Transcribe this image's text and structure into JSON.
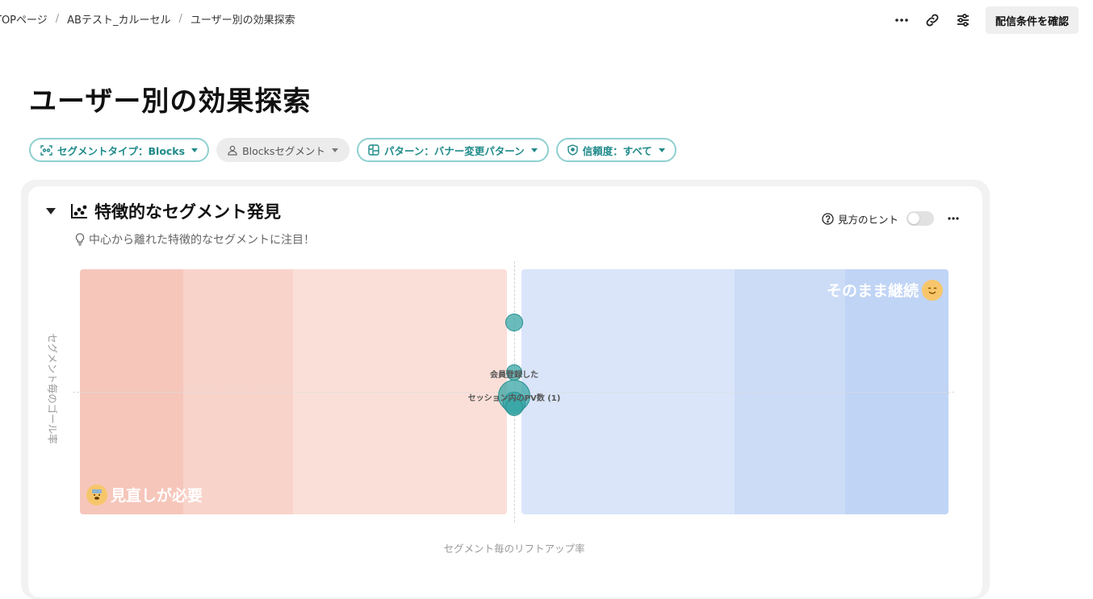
{
  "breadcrumb": [
    "TOPページ",
    "ABテスト_カルーセル",
    "ユーザー別の効果探索"
  ],
  "toolbar": {
    "more_icon": "more-horizontal-icon",
    "link_icon": "link-icon",
    "settings_icon": "sliders-icon",
    "confirm_label": "配信条件を確認"
  },
  "page": {
    "title": "ユーザー別の効果探索"
  },
  "filters": [
    {
      "label": "セグメントタイプ：Blocks",
      "icon": "segment-type-icon"
    },
    {
      "label": "Blocksセグメント",
      "icon": "user-icon"
    },
    {
      "label": "パターン：バナー変更パターン",
      "icon": "pattern-icon"
    },
    {
      "label": "信頼度：すべて",
      "icon": "shield-icon"
    }
  ],
  "card": {
    "title": "特徴的なセグメント発見",
    "subtitle": "中心から離れた特徴的なセグメントに注目！",
    "hint_label": "見方のヒント",
    "hint_enabled": false
  },
  "chart_data": {
    "type": "scatter",
    "xlabel": "セグメント毎のリフトアップ率",
    "ylabel": "セグメント毎のゴール率",
    "quadrant_labels": {
      "top_right": "そのまま継続",
      "bottom_left": "見直しが必要"
    },
    "colors": {
      "negative_zone": "#f6c6bb",
      "positive_zone": "#c3d5f5",
      "point": "#38a6a6"
    },
    "points": [
      {
        "label": "",
        "x": 0.0,
        "y": 0.36
      },
      {
        "label": "会員登録した",
        "x": 0.0,
        "y": 0.1
      },
      {
        "label": "セッション内のPV数 (1)",
        "x": 0.0,
        "y": -0.02
      },
      {
        "label": "",
        "x": 0.0,
        "y": -0.06
      },
      {
        "label": "",
        "x": 0.0,
        "y": -0.08
      }
    ]
  }
}
